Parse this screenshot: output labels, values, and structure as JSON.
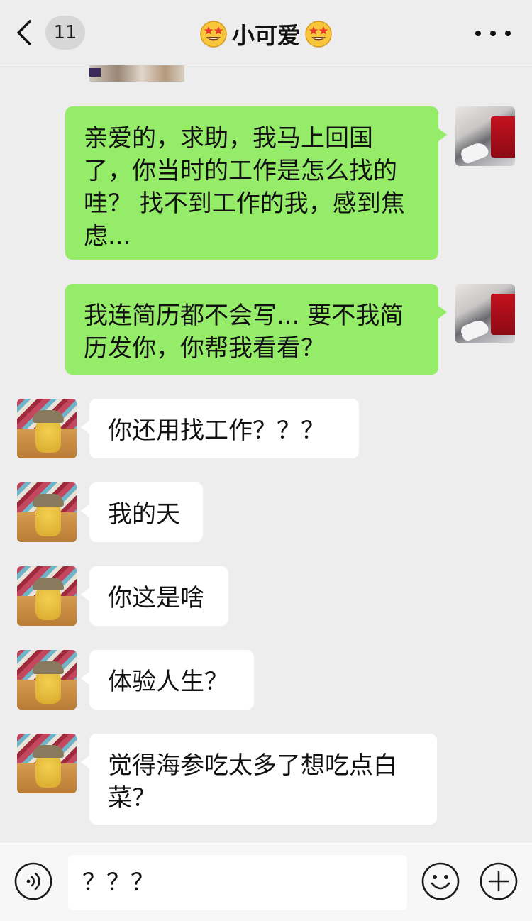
{
  "header": {
    "back_count": "11",
    "title": "小可爱",
    "title_emoji_name": "star-struck-emoji"
  },
  "messages": [
    {
      "side": "me",
      "text": "亲爱的，求助，我马上回国了，你当时的工作是怎么找的哇？ 找不到工作的我，感到焦虑..."
    },
    {
      "side": "me",
      "text": "我连简历都不会写... 要不我简历发你，你帮我看看？"
    },
    {
      "side": "them",
      "text": "你还用找工作？？？"
    },
    {
      "side": "them",
      "text": "我的天"
    },
    {
      "side": "them",
      "text": "你这是啥"
    },
    {
      "side": "them",
      "text": "体验人生？"
    },
    {
      "side": "them",
      "text": "觉得海参吃太多了想吃点白菜？"
    }
  ],
  "input": {
    "value": "？？？"
  },
  "colors": {
    "my_bubble": "#95ec69",
    "their_bubble": "#ffffff",
    "background": "#ededed"
  }
}
